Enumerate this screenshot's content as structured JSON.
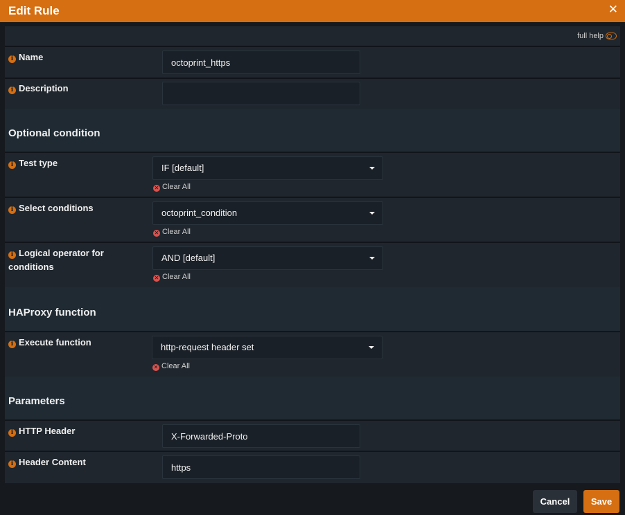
{
  "dialog": {
    "title": "Edit Rule",
    "close_glyph": "✕"
  },
  "full_help": {
    "label": "full help"
  },
  "fields": {
    "name": {
      "label": "Name",
      "value": "octoprint_https"
    },
    "description": {
      "label": "Description",
      "value": ""
    }
  },
  "sections": {
    "optional_condition": "Optional condition",
    "haproxy_function": "HAProxy function",
    "parameters": "Parameters"
  },
  "conditions": {
    "test_type": {
      "label": "Test type",
      "value": "IF [default]"
    },
    "select_conditions": {
      "label": "Select conditions",
      "value": "octoprint_condition"
    },
    "logical_operator": {
      "label": "Logical operator for conditions",
      "value": "AND [default]"
    }
  },
  "function": {
    "execute": {
      "label": "Execute function",
      "value": "http-request header set"
    }
  },
  "params": {
    "http_header": {
      "label": "HTTP Header",
      "value": "X-Forwarded-Proto"
    },
    "header_content": {
      "label": "Header Content",
      "value": "https"
    }
  },
  "clear_all_label": "Clear All",
  "buttons": {
    "cancel": "Cancel",
    "save": "Save"
  },
  "icons": {
    "info": "info-icon",
    "clear": "clear-circle-icon",
    "toggle": "toggle-icon",
    "caret": "chevron-down-icon"
  },
  "colors": {
    "accent": "#d56f12",
    "danger": "#d9534f",
    "panel": "#1f262d"
  }
}
